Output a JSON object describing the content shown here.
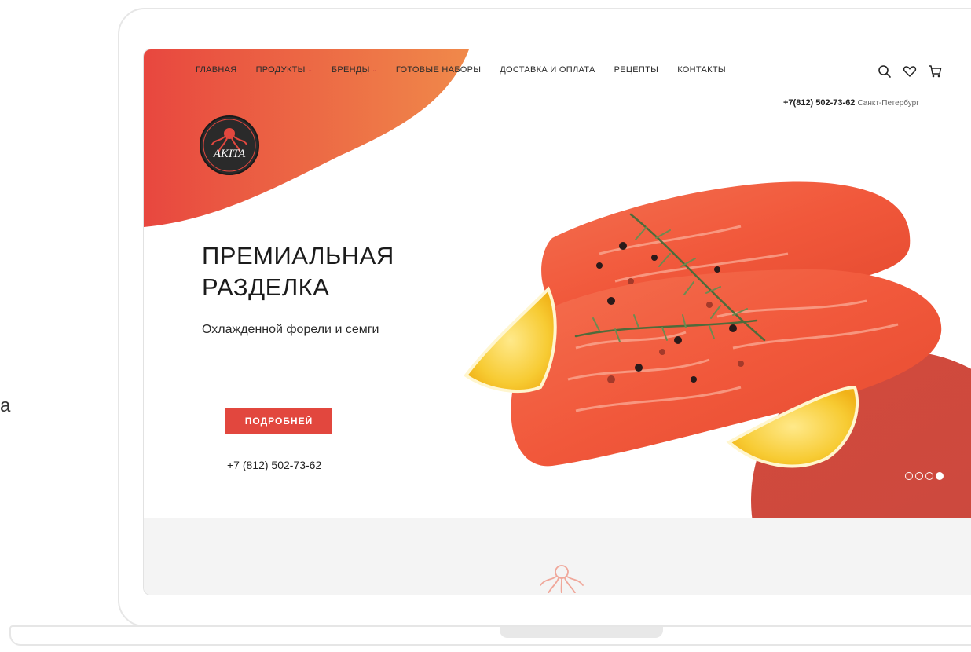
{
  "nav": {
    "items": [
      {
        "label": "ГЛАВНАЯ",
        "active": true,
        "dropdown": false
      },
      {
        "label": "ПРОДУКТЫ",
        "active": false,
        "dropdown": true
      },
      {
        "label": "БРЕНДЫ",
        "active": false,
        "dropdown": true
      },
      {
        "label": "ГОТОВЫЕ НАБОРЫ",
        "active": false,
        "dropdown": false
      },
      {
        "label": "ДОСТАВКА И ОПЛАТА",
        "active": false,
        "dropdown": false
      },
      {
        "label": "РЕЦЕПТЫ",
        "active": false,
        "dropdown": false
      },
      {
        "label": "КОНТАКТЫ",
        "active": false,
        "dropdown": false
      }
    ]
  },
  "header": {
    "phone": "+7(812) 502-73-62",
    "city": "Санкт-Петербург",
    "icons": [
      "search-icon",
      "heart-icon",
      "cart-icon"
    ]
  },
  "logo": {
    "text": "AKITA"
  },
  "hero": {
    "title_line1": "ПРЕМИАЛЬНАЯ",
    "title_line2": "РАЗДЕЛКА",
    "subtitle": "Охлажденной форели и семги",
    "button_label": "ПОДРОБНЕЙ",
    "phone": "+7 (812) 502-73-62"
  },
  "slider": {
    "count": 4,
    "active_index": 3
  },
  "side_letter": "a",
  "colors": {
    "accent": "#e2473e",
    "gradient_start": "#e8473f",
    "gradient_end": "#f0894a",
    "circle": "#d24a3c"
  }
}
